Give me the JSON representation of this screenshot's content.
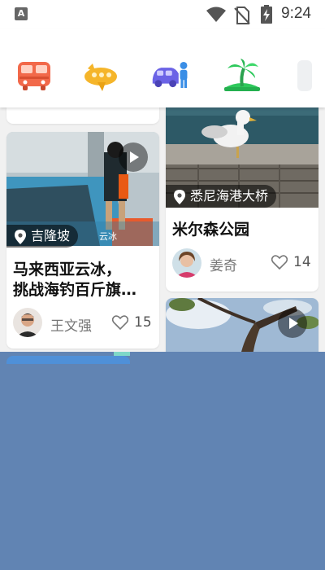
{
  "status_bar": {
    "time": "9:24",
    "notification_icon": "A"
  },
  "categories": [
    {
      "icon": "bus-icon",
      "color": "#f2694a"
    },
    {
      "icon": "plane-icon",
      "color": "#f5b52a"
    },
    {
      "icon": "car-person-icon",
      "color": "#6b63e6"
    },
    {
      "icon": "palm-island-icon",
      "color": "#2ec95c"
    }
  ],
  "cards": {
    "left_top": {},
    "left_main": {
      "location": "吉隆坡",
      "watermark": "云冰",
      "title_line1": "马来西亚云冰，",
      "title_line2": "挑战海钓百斤旗…",
      "author": "王文强",
      "likes": "15"
    },
    "right_main": {
      "location": "悉尼海港大桥",
      "title": "米尔森公园",
      "author": "姜奇",
      "likes": "14"
    },
    "right_bottom": {}
  }
}
